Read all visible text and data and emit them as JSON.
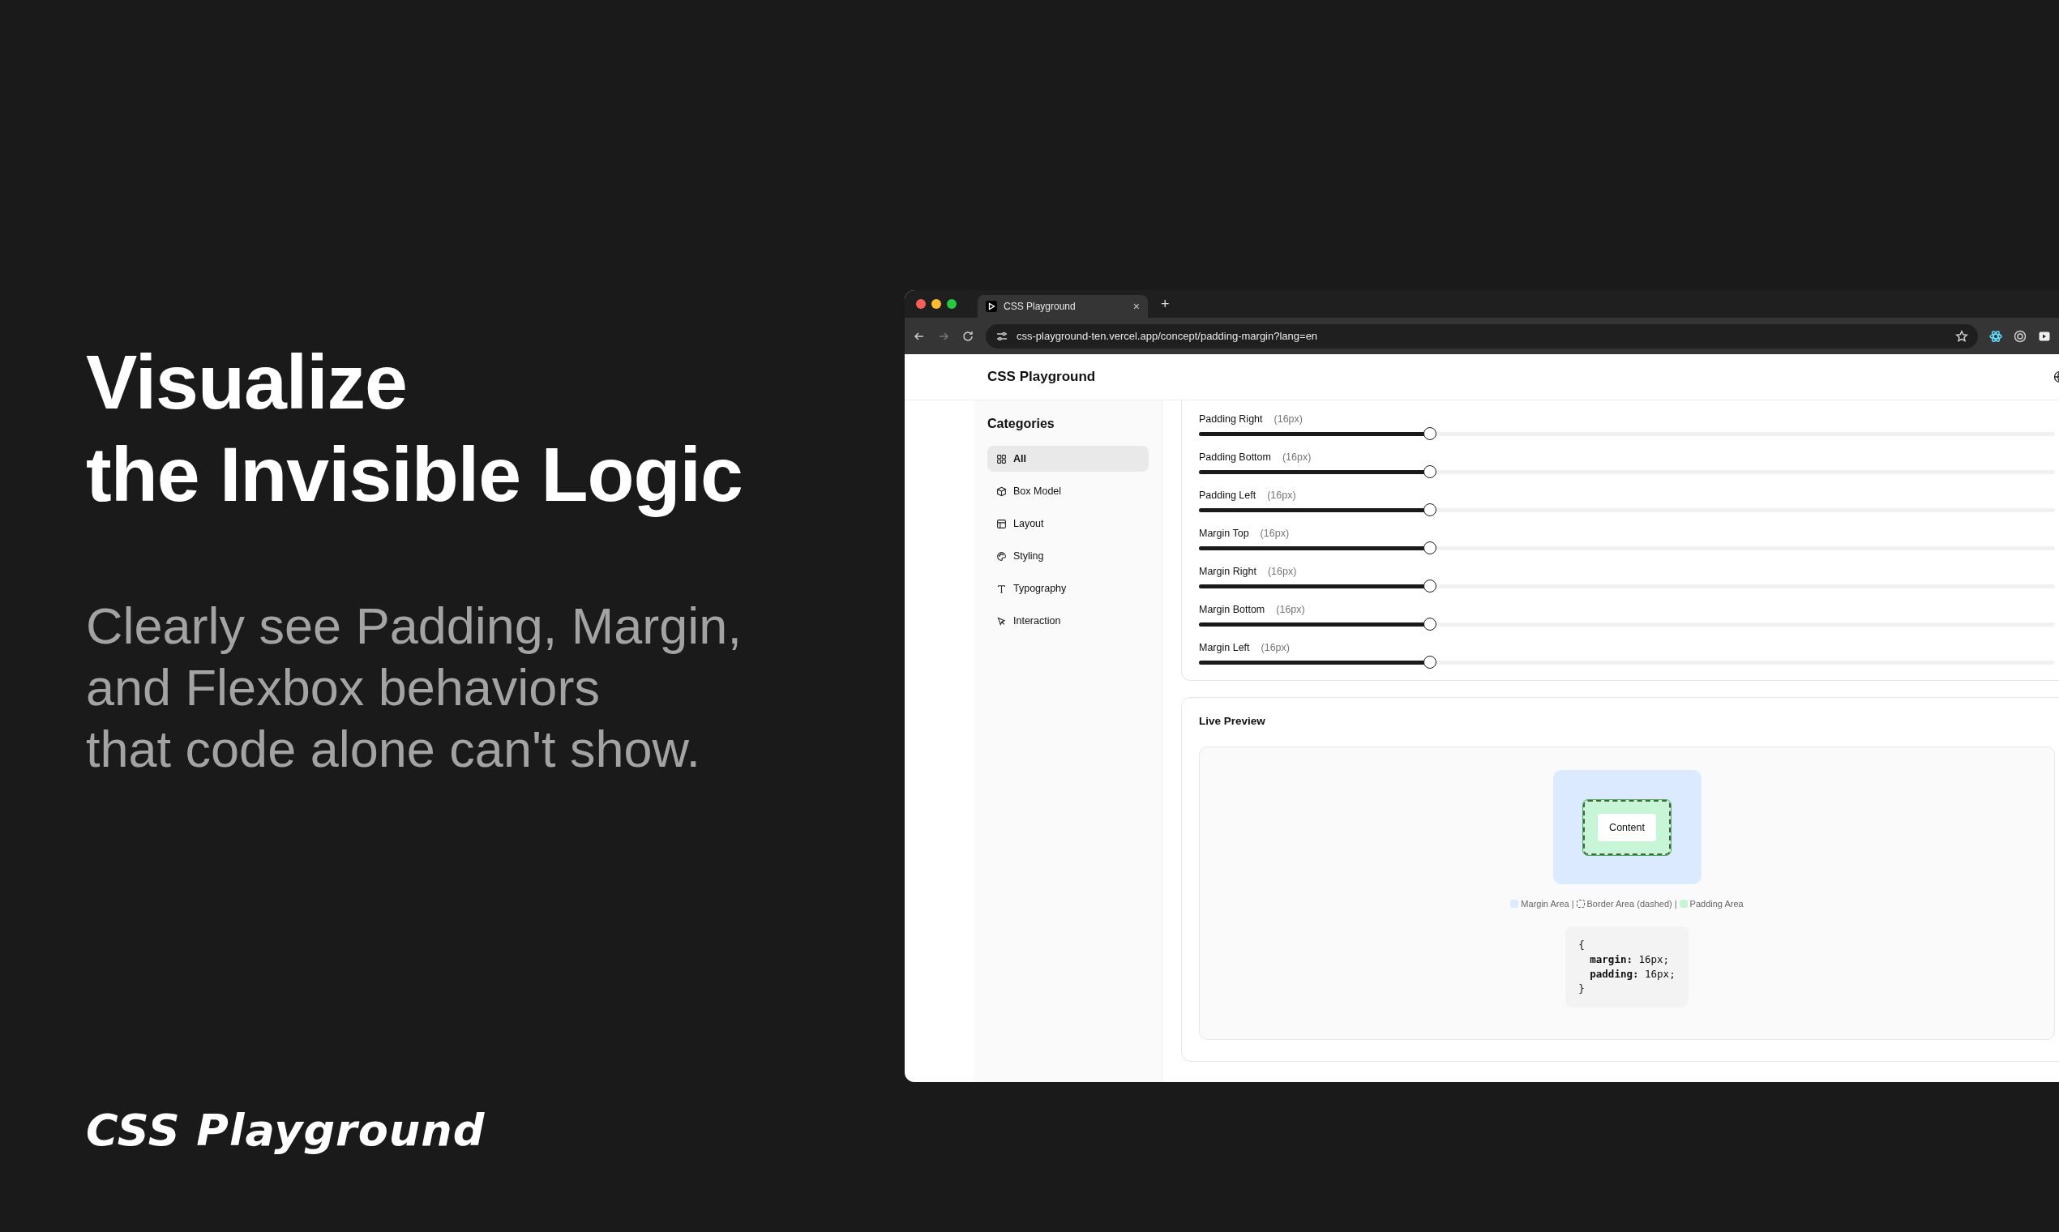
{
  "hero": {
    "heading_lines": [
      "Visualize",
      "the Invisible Logic"
    ],
    "subtitle_lines": [
      "Clearly see Padding, Margin,",
      "and Flexbox behaviors",
      "that code alone can't show."
    ],
    "brand": "CSS Playground"
  },
  "browser": {
    "tab": {
      "title": "CSS Playground",
      "close": "×"
    },
    "new_tab": "+",
    "url": "css-playground-ten.vercel.app/concept/padding-margin?lang=en"
  },
  "page": {
    "title": "CSS Playground",
    "sidebar": {
      "title": "Categories",
      "items": [
        {
          "label": "All",
          "selected": true
        },
        {
          "label": "Box Model",
          "selected": false
        },
        {
          "label": "Layout",
          "selected": false
        },
        {
          "label": "Styling",
          "selected": false
        },
        {
          "label": "Typography",
          "selected": false
        },
        {
          "label": "Interaction",
          "selected": false
        }
      ]
    },
    "sliders": [
      {
        "label": "Padding Right",
        "value": "(16px)",
        "level": 0.27
      },
      {
        "label": "Padding Bottom",
        "value": "(16px)",
        "level": 0.27
      },
      {
        "label": "Padding Left",
        "value": "(16px)",
        "level": 0.27
      },
      {
        "label": "Margin Top",
        "value": "(16px)",
        "level": 0.27
      },
      {
        "label": "Margin Right",
        "value": "(16px)",
        "level": 0.27
      },
      {
        "label": "Margin Bottom",
        "value": "(16px)",
        "level": 0.27
      },
      {
        "label": "Margin Left",
        "value": "(16px)",
        "level": 0.27
      }
    ],
    "preview": {
      "title": "Live Preview",
      "content": "Content",
      "legend": [
        {
          "kind": "fill",
          "color": "#dbeafe",
          "label": "Margin Area"
        },
        {
          "kind": "dashed",
          "label": "Border Area (dashed)"
        },
        {
          "kind": "fill",
          "color": "#c6f6d5",
          "label": "Padding Area"
        }
      ],
      "separator": "|",
      "code": {
        "open": "{",
        "declarations": [
          {
            "property": "margin:",
            "value": "16px;"
          },
          {
            "property": "padding:",
            "value": "16px;"
          }
        ],
        "close": "}"
      }
    }
  }
}
